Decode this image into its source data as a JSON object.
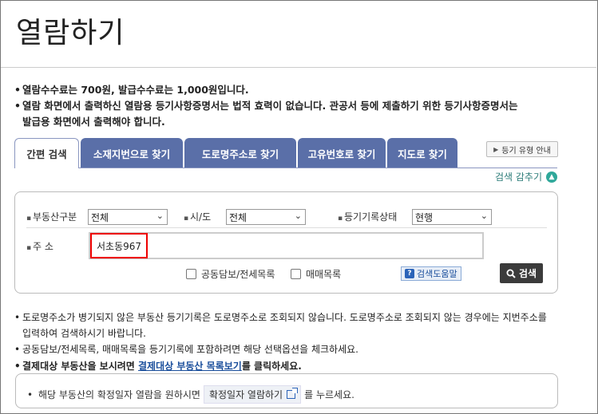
{
  "page_title": "열람하기",
  "notices": [
    "열람수수료는 700원, 발급수수료는 1,000원입니다.",
    "열람 화면에서 출력하신 열람용 등기사항증명서는 법적 효력이 없습니다. 관공서 등에 제출하기 위한 등기사항증명서는",
    "발급용 화면에서 출력해야 합니다."
  ],
  "tabs": [
    {
      "label": "간편 검색"
    },
    {
      "label": "소재지번으로 찾기"
    },
    {
      "label": "도로명주소로 찾기"
    },
    {
      "label": "고유번호로 찾기"
    },
    {
      "label": "지도로 찾기"
    }
  ],
  "guide_button": "등기 유형 안내",
  "collapse_label": "검색 감추기",
  "search": {
    "property_type_label": "부동산구분",
    "property_type_value": "전체",
    "region_label": "시/도",
    "region_value": "전체",
    "status_label": "등기기록상태",
    "status_value": "현행",
    "address_label": "주 소",
    "address_value": "서초동967",
    "check_collateral": "공동담보/전세목록",
    "check_sale": "매매목록",
    "help_label": "검색도움말",
    "search_button": "검색"
  },
  "info": {
    "line1a": "도로명주소가 병기되지 않은 부동산 등기기록은 도로명주소로 조회되지 않습니다. 도로명주소로 조회되지 않는 경우에는 지번주소를",
    "line1b": "입력하여 검색하시기 바랍니다.",
    "line2": "공동담보/전세목록, 매매목록을 등기기록에 포함하려면 해당 선택옵션을 체크하세요.",
    "line3_pre": "결제대상 부동산을 보시려면 ",
    "line3_link": "결제대상 부동산 목록보기",
    "line3_post": "를 클릭하세요."
  },
  "bottom": {
    "pre": "해당 부동산의 확정일자 열람을 원하시면",
    "button": "확정일자 열람하기",
    "post": "를 누르세요."
  }
}
